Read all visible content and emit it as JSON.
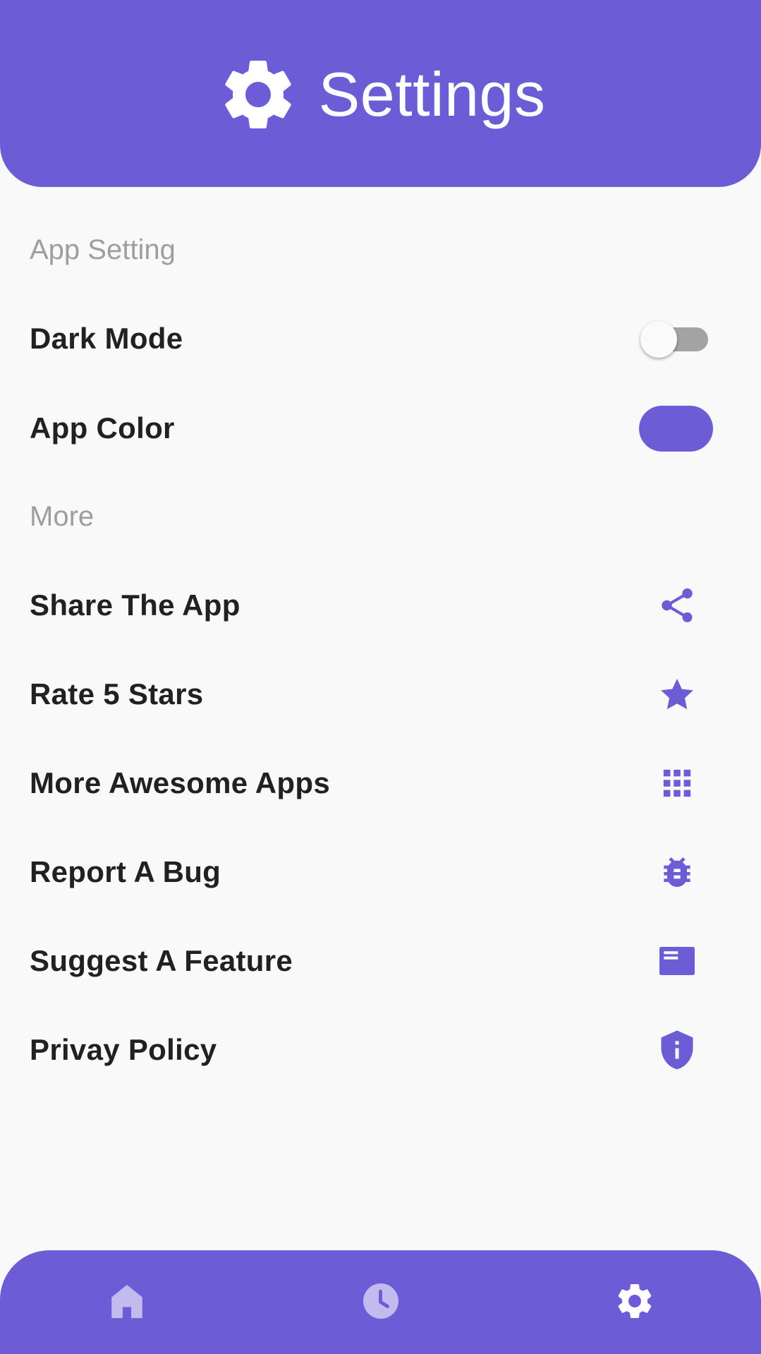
{
  "header": {
    "title": "Settings",
    "icon": "gear-icon"
  },
  "sections": {
    "app_setting": "App Setting",
    "more": "More"
  },
  "app_settings": {
    "dark_mode": {
      "label": "Dark Mode",
      "enabled": false
    },
    "app_color": {
      "label": "App Color",
      "color": "#6c5dd6"
    }
  },
  "more_items": [
    {
      "label": "Share The App",
      "icon": "share-icon"
    },
    {
      "label": "Rate 5 Stars",
      "icon": "star-icon"
    },
    {
      "label": "More Awesome Apps",
      "icon": "apps-grid-icon"
    },
    {
      "label": "Report A Bug",
      "icon": "bug-icon"
    },
    {
      "label": "Suggest A Feature",
      "icon": "feature-card-icon"
    },
    {
      "label": "Privay Policy",
      "icon": "privacy-shield-icon"
    }
  ],
  "bottom_nav": [
    {
      "name": "home",
      "icon": "home-icon",
      "active": false
    },
    {
      "name": "history",
      "icon": "clock-icon",
      "active": false
    },
    {
      "name": "settings",
      "icon": "gear-icon",
      "active": true
    }
  ],
  "colors": {
    "accent": "#6c5dd6",
    "inactive_nav": "#c3bbf0",
    "background": "#f9f9f9"
  }
}
